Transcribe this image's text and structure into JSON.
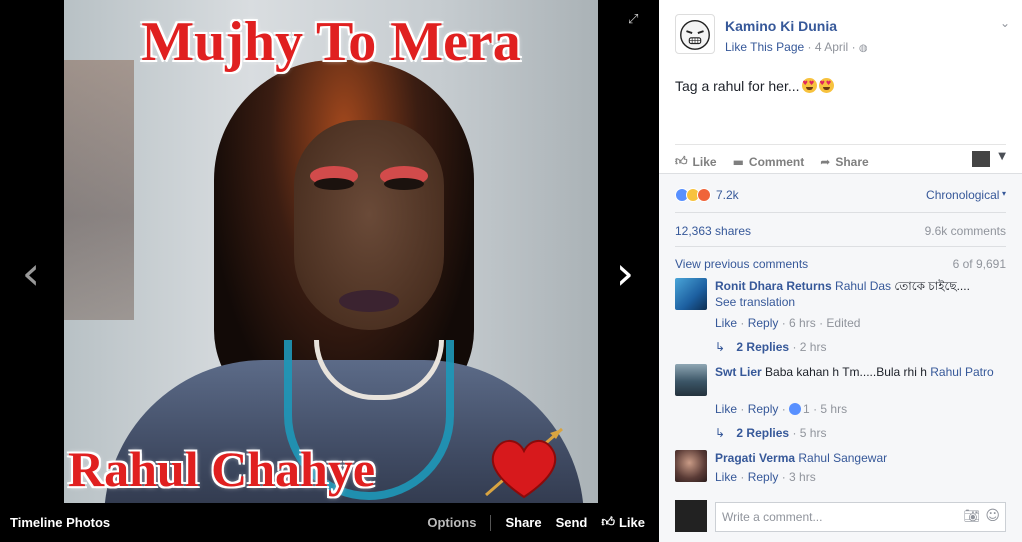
{
  "photo": {
    "caption_top": "Mujhy To Mera",
    "caption_bottom": "Rahul Chahye"
  },
  "viewer": {
    "album_title": "Timeline Photos",
    "options_label": "Options",
    "share_label": "Share",
    "send_label": "Send",
    "like_label": "Like"
  },
  "post": {
    "page_name": "Kamino Ki Dunia",
    "like_page_label": "Like This Page",
    "date": "4 April",
    "text": "Tag a rahul for her...",
    "actions": {
      "like": "Like",
      "comment": "Comment",
      "share": "Share"
    }
  },
  "feedback": {
    "reaction_count": "7.2k",
    "sort_label": "Chronological",
    "shares": "12,363 shares",
    "comments_total": "9.6k comments",
    "view_previous": "View previous comments",
    "comment_range": "6 of 9,691"
  },
  "comments": [
    {
      "author": "Ronit Dhara Returns",
      "mention": "Rahul Das",
      "text": "তোকে চাইছে....",
      "see_translation": "See translation",
      "like": "Like",
      "reply": "Reply",
      "time": "6 hrs",
      "edited": "Edited",
      "replies": "2 Replies",
      "replies_time": "2 hrs"
    },
    {
      "author": "Swt Lier",
      "text": "Baba kahan h Tm.....Bula rhi h",
      "mention": "Rahul Patro",
      "like": "Like",
      "reply": "Reply",
      "likes_count": "1",
      "time": "5 hrs",
      "replies": "2 Replies",
      "replies_time": "5 hrs"
    },
    {
      "author": "Pragati Verma",
      "mention": "Rahul Sangewar",
      "like": "Like",
      "reply": "Reply",
      "time": "3 hrs"
    }
  ],
  "composer": {
    "placeholder": "Write a comment..."
  },
  "colors": {
    "link": "#365899",
    "muted": "#90949c",
    "caption_red": "#e02020",
    "viewer_bg": "#000000"
  },
  "icons": [
    "chevron-left-icon",
    "chevron-right-icon",
    "expand-icon",
    "thumbs-up-icon",
    "comment-icon",
    "share-icon",
    "globe-icon",
    "camera-icon",
    "emoji-icon",
    "reply-arrow-icon"
  ]
}
